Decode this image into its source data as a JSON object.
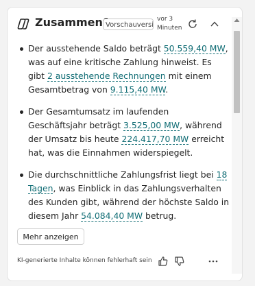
{
  "header": {
    "title": "Zusammenf…",
    "badge": "Vorschauversion",
    "time": "vor 3 Minuten",
    "icon": "copilot-icon"
  },
  "bullets": [
    {
      "parts": [
        {
          "text": "Der ausstehende Saldo beträgt "
        },
        {
          "text": "50.559,40 MW",
          "link": true
        },
        {
          "text": ", was auf eine kritische Zahlung hinweist. Es gibt "
        },
        {
          "text": "2 ausstehende Rechnungen",
          "link": true
        },
        {
          "text": " mit einem Gesamtbetrag von "
        },
        {
          "text": "9.115,40 MW",
          "link": true
        },
        {
          "text": "."
        }
      ]
    },
    {
      "parts": [
        {
          "text": "Der Gesamtumsatz im laufenden Geschäftsjahr beträgt "
        },
        {
          "text": "3.525,00 MW",
          "link": true
        },
        {
          "text": ", während der Umsatz bis heute "
        },
        {
          "text": "224.417,70 MW",
          "link": true
        },
        {
          "text": " erreicht hat, was die Einnahmen widerspiegelt."
        }
      ]
    },
    {
      "parts": [
        {
          "text": "Die durchschnittliche Zahlungsfrist liegt bei "
        },
        {
          "text": "18 Tagen",
          "link": true
        },
        {
          "text": ", was Einblick in das Zahlungsverhalten des Kunden gibt, während der höchste Saldo in diesem Jahr "
        },
        {
          "text": "54.084,40 MW",
          "link": true
        },
        {
          "text": " betrug."
        }
      ]
    }
  ],
  "actions": {
    "show_more": "Mehr anzeigen"
  },
  "footer": {
    "disclaimer": "KI-generierte Inhalte können fehlerhaft sein"
  },
  "colors": {
    "link": "#0f6c74",
    "text": "#242424"
  }
}
